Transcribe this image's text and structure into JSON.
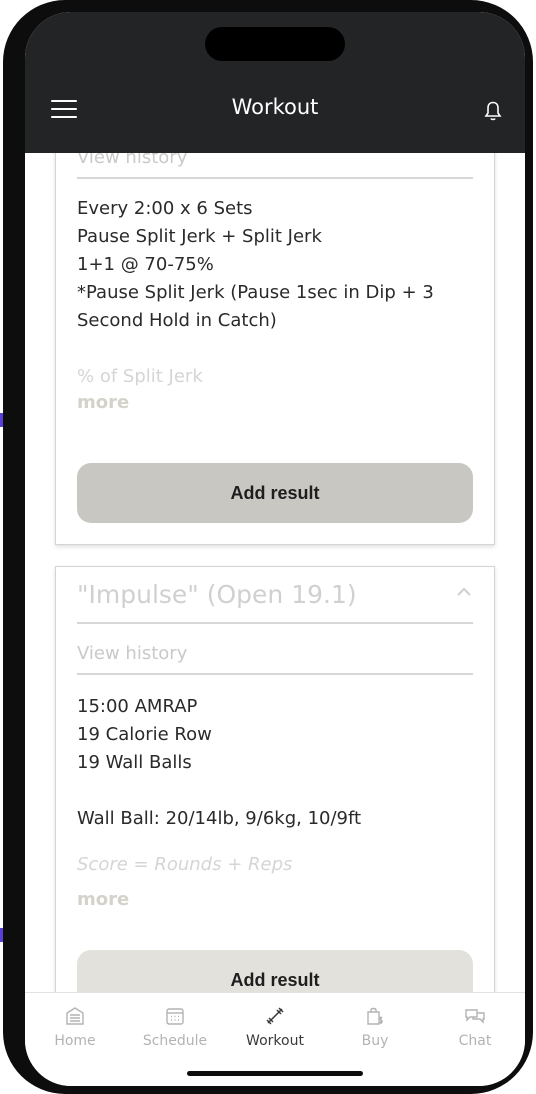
{
  "header": {
    "title": "Workout"
  },
  "card1": {
    "history_label": "View history",
    "description": [
      "Every 2:00 x 6 Sets",
      "Pause Split Jerk + Split Jerk",
      "1+1 @ 70-75%",
      "*Pause Split Jerk (Pause 1sec in Dip + 3 Second Hold in Catch)"
    ],
    "faint_line": "% of Split Jerk",
    "more_label": "more",
    "add_result_label": "Add result"
  },
  "card2": {
    "title": "\"Impulse\" (Open 19.1)",
    "history_label": "View history",
    "description": [
      "15:00 AMRAP",
      "19 Calorie Row",
      "19 Wall Balls",
      "",
      "Wall Ball: 20/14lb, 9/6kg, 10/9ft"
    ],
    "faint_line": "Score = Rounds + Reps",
    "more_label": "more",
    "add_result_label": "Add result"
  },
  "tabbar": {
    "items": [
      {
        "label": "Home",
        "icon": "home-icon",
        "active": false
      },
      {
        "label": "Schedule",
        "icon": "calendar-icon",
        "active": false
      },
      {
        "label": "Workout",
        "icon": "dumbbell-icon",
        "active": true
      },
      {
        "label": "Buy",
        "icon": "shopping-bag-icon",
        "active": false
      },
      {
        "label": "Chat",
        "icon": "chat-icon",
        "active": false
      }
    ]
  },
  "colors": {
    "header_bg": "#232425",
    "button_bg": "#c9c7c1",
    "active_tab": "#3a3a3a",
    "inactive_tab": "#b3b3b3"
  }
}
